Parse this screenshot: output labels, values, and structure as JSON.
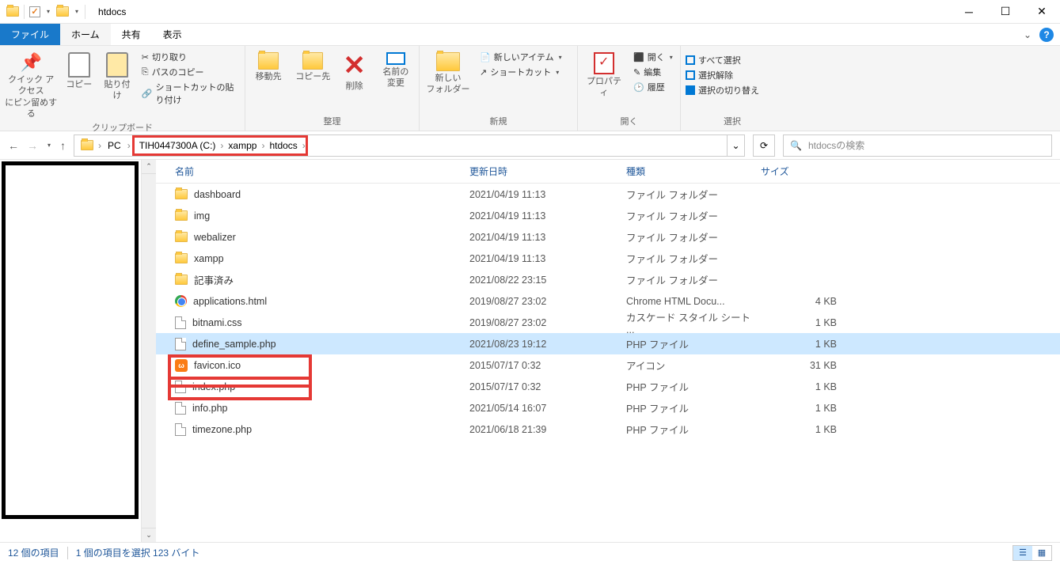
{
  "window": {
    "title": "htdocs"
  },
  "menubar": {
    "file": "ファイル",
    "tabs": [
      "ホーム",
      "共有",
      "表示"
    ],
    "active": 0
  },
  "ribbon": {
    "clipboard": {
      "label": "クリップボード",
      "quick_access": "クイック アクセス\nにピン留めする",
      "copy": "コピー",
      "paste": "貼り付け",
      "cut": "切り取り",
      "copy_path": "パスのコピー",
      "paste_shortcut": "ショートカットの貼り付け"
    },
    "organize": {
      "label": "整理",
      "move_to": "移動先",
      "copy_to": "コピー先",
      "delete": "削除",
      "rename": "名前の\n変更"
    },
    "new": {
      "label": "新規",
      "new_folder": "新しい\nフォルダー",
      "new_item": "新しいアイテム",
      "shortcut": "ショートカット"
    },
    "open": {
      "label": "開く",
      "properties": "プロパティ",
      "open": "開く",
      "edit": "編集",
      "history": "履歴"
    },
    "select": {
      "label": "選択",
      "select_all": "すべて選択",
      "select_none": "選択解除",
      "invert": "選択の切り替え"
    }
  },
  "breadcrumb": {
    "pc": "PC",
    "drive": "TIH0447300A (C:)",
    "p1": "xampp",
    "p2": "htdocs"
  },
  "search": {
    "placeholder": "htdocsの検索"
  },
  "columns": {
    "name": "名前",
    "date": "更新日時",
    "type": "種類",
    "size": "サイズ"
  },
  "files": [
    {
      "icon": "folder",
      "name": "dashboard",
      "date": "2021/04/19 11:13",
      "type": "ファイル フォルダー",
      "size": ""
    },
    {
      "icon": "folder",
      "name": "img",
      "date": "2021/04/19 11:13",
      "type": "ファイル フォルダー",
      "size": ""
    },
    {
      "icon": "folder",
      "name": "webalizer",
      "date": "2021/04/19 11:13",
      "type": "ファイル フォルダー",
      "size": ""
    },
    {
      "icon": "folder",
      "name": "xampp",
      "date": "2021/04/19 11:13",
      "type": "ファイル フォルダー",
      "size": ""
    },
    {
      "icon": "folder",
      "name": "記事済み",
      "date": "2021/08/22 23:15",
      "type": "ファイル フォルダー",
      "size": ""
    },
    {
      "icon": "chrome",
      "name": "applications.html",
      "date": "2019/08/27 23:02",
      "type": "Chrome HTML Docu...",
      "size": "4 KB"
    },
    {
      "icon": "doc",
      "name": "bitnami.css",
      "date": "2019/08/27 23:02",
      "type": "カスケード スタイル シート ...",
      "size": "1 KB"
    },
    {
      "icon": "doc",
      "name": "define_sample.php",
      "date": "2021/08/23 19:12",
      "type": "PHP ファイル",
      "size": "1 KB",
      "selected": true
    },
    {
      "icon": "xampp",
      "name": "favicon.ico",
      "date": "2015/07/17 0:32",
      "type": "アイコン",
      "size": "31 KB"
    },
    {
      "icon": "doc",
      "name": "index.php",
      "date": "2015/07/17 0:32",
      "type": "PHP ファイル",
      "size": "1 KB"
    },
    {
      "icon": "doc",
      "name": "info.php",
      "date": "2021/05/14 16:07",
      "type": "PHP ファイル",
      "size": "1 KB"
    },
    {
      "icon": "doc",
      "name": "timezone.php",
      "date": "2021/06/18 21:39",
      "type": "PHP ファイル",
      "size": "1 KB"
    }
  ],
  "status": {
    "count": "12 個の項目",
    "selection": "1 個の項目を選択 123 バイト"
  }
}
